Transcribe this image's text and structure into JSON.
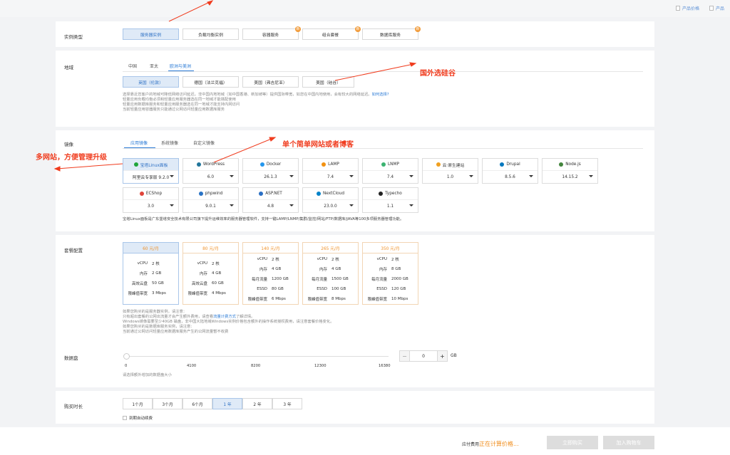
{
  "top_links": {
    "price": "产品价格",
    "product": "产品"
  },
  "instance_type": {
    "label": "实例类型",
    "options": [
      "服务器实例",
      "负载均衡实例",
      "容器服务",
      "组合套餐",
      "数据库服务"
    ],
    "badge": "新"
  },
  "region": {
    "label": "地域",
    "tabs": [
      "中国",
      "亚太",
      "欧洲与美洲"
    ],
    "options": [
      "英国（伦敦）",
      "德国（法兰克福）",
      "美国（弗吉尼亚）",
      "美国（硅谷）"
    ],
    "notes": {
      "line1_pre": "选择靠近您客户的地域可降低网络访问延迟。非中国内地地域（如中国香港、新加坡等）提供国际带宽，如您在中国内地使用，会有较大的网络延迟。",
      "line1_link": "如何选择?",
      "line2": "轻量应用负载均衡必须和轻量应用服务器选在同一地域才能搭配使用",
      "line3": "轻量应用数据库服务和轻量应用服务器选在同一地域才能支持内网访问",
      "line4": "当前轻量应用容器服务只能通过公网访问轻量应用数据库服务"
    }
  },
  "image": {
    "label": "镜像",
    "tabs": [
      "应用镜像",
      "系统镜像",
      "自定义镜像"
    ],
    "cards": [
      {
        "name": "宝塔Linux面板",
        "version": "阿里云专享版 9.2.0",
        "color": "#20a53a"
      },
      {
        "name": "WordPress",
        "version": "6.0",
        "color": "#21759b"
      },
      {
        "name": "Docker",
        "version": "26.1.3",
        "color": "#2496ed"
      },
      {
        "name": "LAMP",
        "version": "7.4",
        "color": "#f29111"
      },
      {
        "name": "LNMP",
        "version": "7.4",
        "color": "#3cb371"
      },
      {
        "name": "云·原生建站",
        "version": "1.0",
        "color": "#f0a020"
      },
      {
        "name": "Drupal",
        "version": "8.5.6",
        "color": "#0678be"
      },
      {
        "name": "Node.js",
        "version": "14.15.2",
        "color": "#43853d"
      },
      {
        "name": "ECShop",
        "version": "3.0",
        "color": "#e0443a"
      },
      {
        "name": "phpwind",
        "version": "9.0.1",
        "color": "#2a73c5"
      },
      {
        "name": "ASP.NET",
        "version": "4.8",
        "color": "#2b6fc4"
      },
      {
        "name": "NextCloud",
        "version": "23.0.0",
        "color": "#0082c9"
      },
      {
        "name": "Typecho",
        "version": "1.1",
        "color": "#222222"
      }
    ],
    "description": "宝塔Linux面板是广东堡塔安全技术有限公司旗下提升运维效率的服务器管理软件，支持一键LAMP/LNMP/集群/监控/网站/FTP/数据库/JAVA等100多项服务器管理功能。"
  },
  "plan": {
    "label": "套餐配置",
    "plans": [
      {
        "price": "60 元/月",
        "rows": [
          [
            "vCPU",
            "2 核"
          ],
          [
            "内存",
            "2 GB"
          ],
          [
            "高效云盘",
            "50 GB"
          ],
          [
            "限峰值带宽",
            "3 Mbps"
          ]
        ]
      },
      {
        "price": "80 元/月",
        "rows": [
          [
            "vCPU",
            "2 核"
          ],
          [
            "内存",
            "4 GB"
          ],
          [
            "高效云盘",
            "60 GB"
          ],
          [
            "限峰值带宽",
            "4 Mbps"
          ]
        ]
      },
      {
        "price": "140 元/月",
        "rows": [
          [
            "vCPU",
            "2 核"
          ],
          [
            "内存",
            "4 GB"
          ],
          [
            "每月流量",
            "1200 GB"
          ],
          [
            "ESSD",
            "80 GB"
          ],
          [
            "限峰值带宽",
            "6 Mbps"
          ]
        ]
      },
      {
        "price": "265 元/月",
        "rows": [
          [
            "vCPU",
            "2 核"
          ],
          [
            "内存",
            "4 GB"
          ],
          [
            "每月流量",
            "1500 GB"
          ],
          [
            "ESSD",
            "100 GB"
          ],
          [
            "限峰值带宽",
            "8 Mbps"
          ]
        ]
      },
      {
        "price": "350 元/月",
        "rows": [
          [
            "vCPU",
            "2 核"
          ],
          [
            "内存",
            "8 GB"
          ],
          [
            "每月流量",
            "2000 GB"
          ],
          [
            "ESSD",
            "120 GB"
          ],
          [
            "限峰值带宽",
            "10 Mbps"
          ]
        ]
      }
    ],
    "notes": {
      "l1": "如果您购买的是服务器实例，请注意：",
      "l2_pre": "只有超出套餐的公网出流量才会产生额外费用，请查看",
      "l2_link": "流量计费方式",
      "l2_post": "了解详情。",
      "l3": "Windows镜像需要至少40GB 磁盘，非中国大陆地域Windows实例价格包含额外的操作系统授权费用，请注意套餐价格变化。",
      "l4": "如果您购买的是数据库服务实例，请注意：",
      "l5": "当前通过公网访问轻量应用数据库服务产生的公网流量暂不收费"
    }
  },
  "disk": {
    "label": "数据盘",
    "ticks": [
      "0",
      "4100",
      "8200",
      "12300",
      "16380"
    ],
    "value": "0",
    "unit": "GB",
    "minus": "−",
    "plus": "+",
    "hint": "请选择额外增加的数据盘大小"
  },
  "duration": {
    "label": "购买时长",
    "options": [
      "1个月",
      "3个月",
      "6个月",
      "1 年",
      "2 年",
      "3 年"
    ],
    "auto_renew": "到期自动续费"
  },
  "footer": {
    "fee_label": "应付费用",
    "fee_value": "正在计算价格...",
    "buy": "立即购买",
    "cart": "加入购物车"
  },
  "annotations": {
    "overseas": "国外选硅谷",
    "single_site": "单个简单网站或者博客",
    "multi_site": "多网站，方便管理升级"
  }
}
